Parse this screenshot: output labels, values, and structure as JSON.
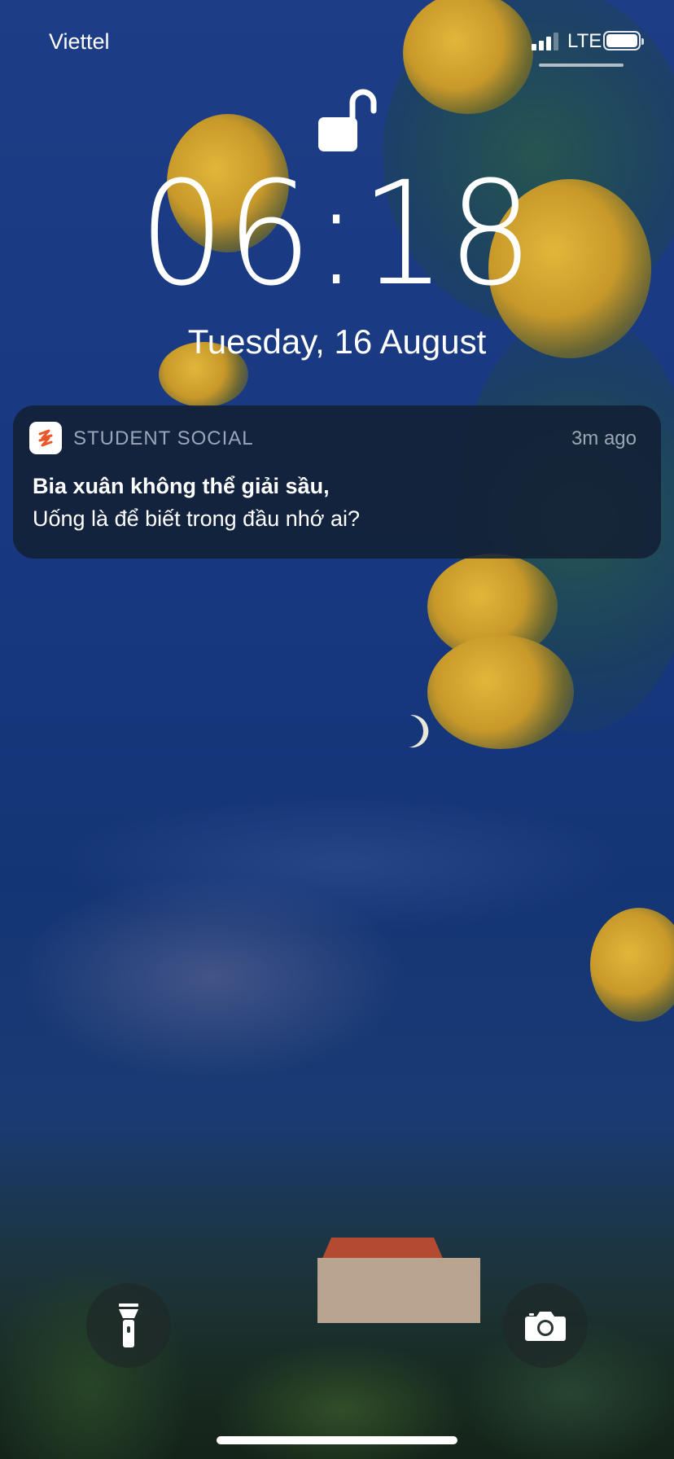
{
  "status_bar": {
    "carrier": "Viettel",
    "network": "LTE",
    "signal_bars": 3,
    "battery_level": 1.0
  },
  "lock_screen": {
    "lock_state": "unlocked",
    "time": "06:18",
    "date": "Tuesday, 16 August"
  },
  "notification": {
    "app_name": "STUDENT SOCIAL",
    "app_icon": "student-social-logo",
    "timestamp": "3m ago",
    "title": "Bia xuân không thể giải sầu,",
    "body": "Uống là để biết trong đầu nhớ ai?",
    "accent": "#e8592a"
  },
  "quick_actions": {
    "left_icon": "flashlight-icon",
    "right_icon": "camera-icon"
  }
}
